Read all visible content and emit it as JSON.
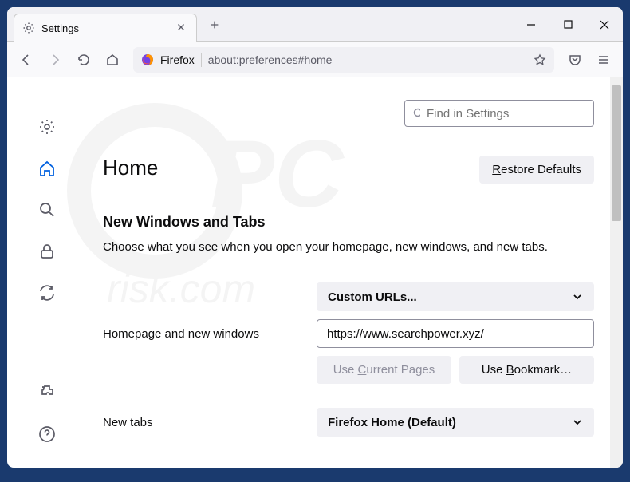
{
  "tab": {
    "title": "Settings"
  },
  "urlbar": {
    "prefix": "Firefox",
    "url": "about:preferences#home"
  },
  "search": {
    "placeholder": "Find in Settings"
  },
  "page": {
    "title": "Home",
    "restore": "Restore Defaults",
    "section_title": "New Windows and Tabs",
    "section_desc": "Choose what you see when you open your homepage, new windows, and new tabs."
  },
  "form": {
    "homepage_label": "Homepage and new windows",
    "custom_select": "Custom URLs...",
    "url_value": "https://www.searchpower.xyz/",
    "use_current": "Use Current Pages",
    "use_bookmark": "Use Bookmark…",
    "newtabs_label": "New tabs",
    "newtabs_select": "Firefox Home (Default)"
  }
}
